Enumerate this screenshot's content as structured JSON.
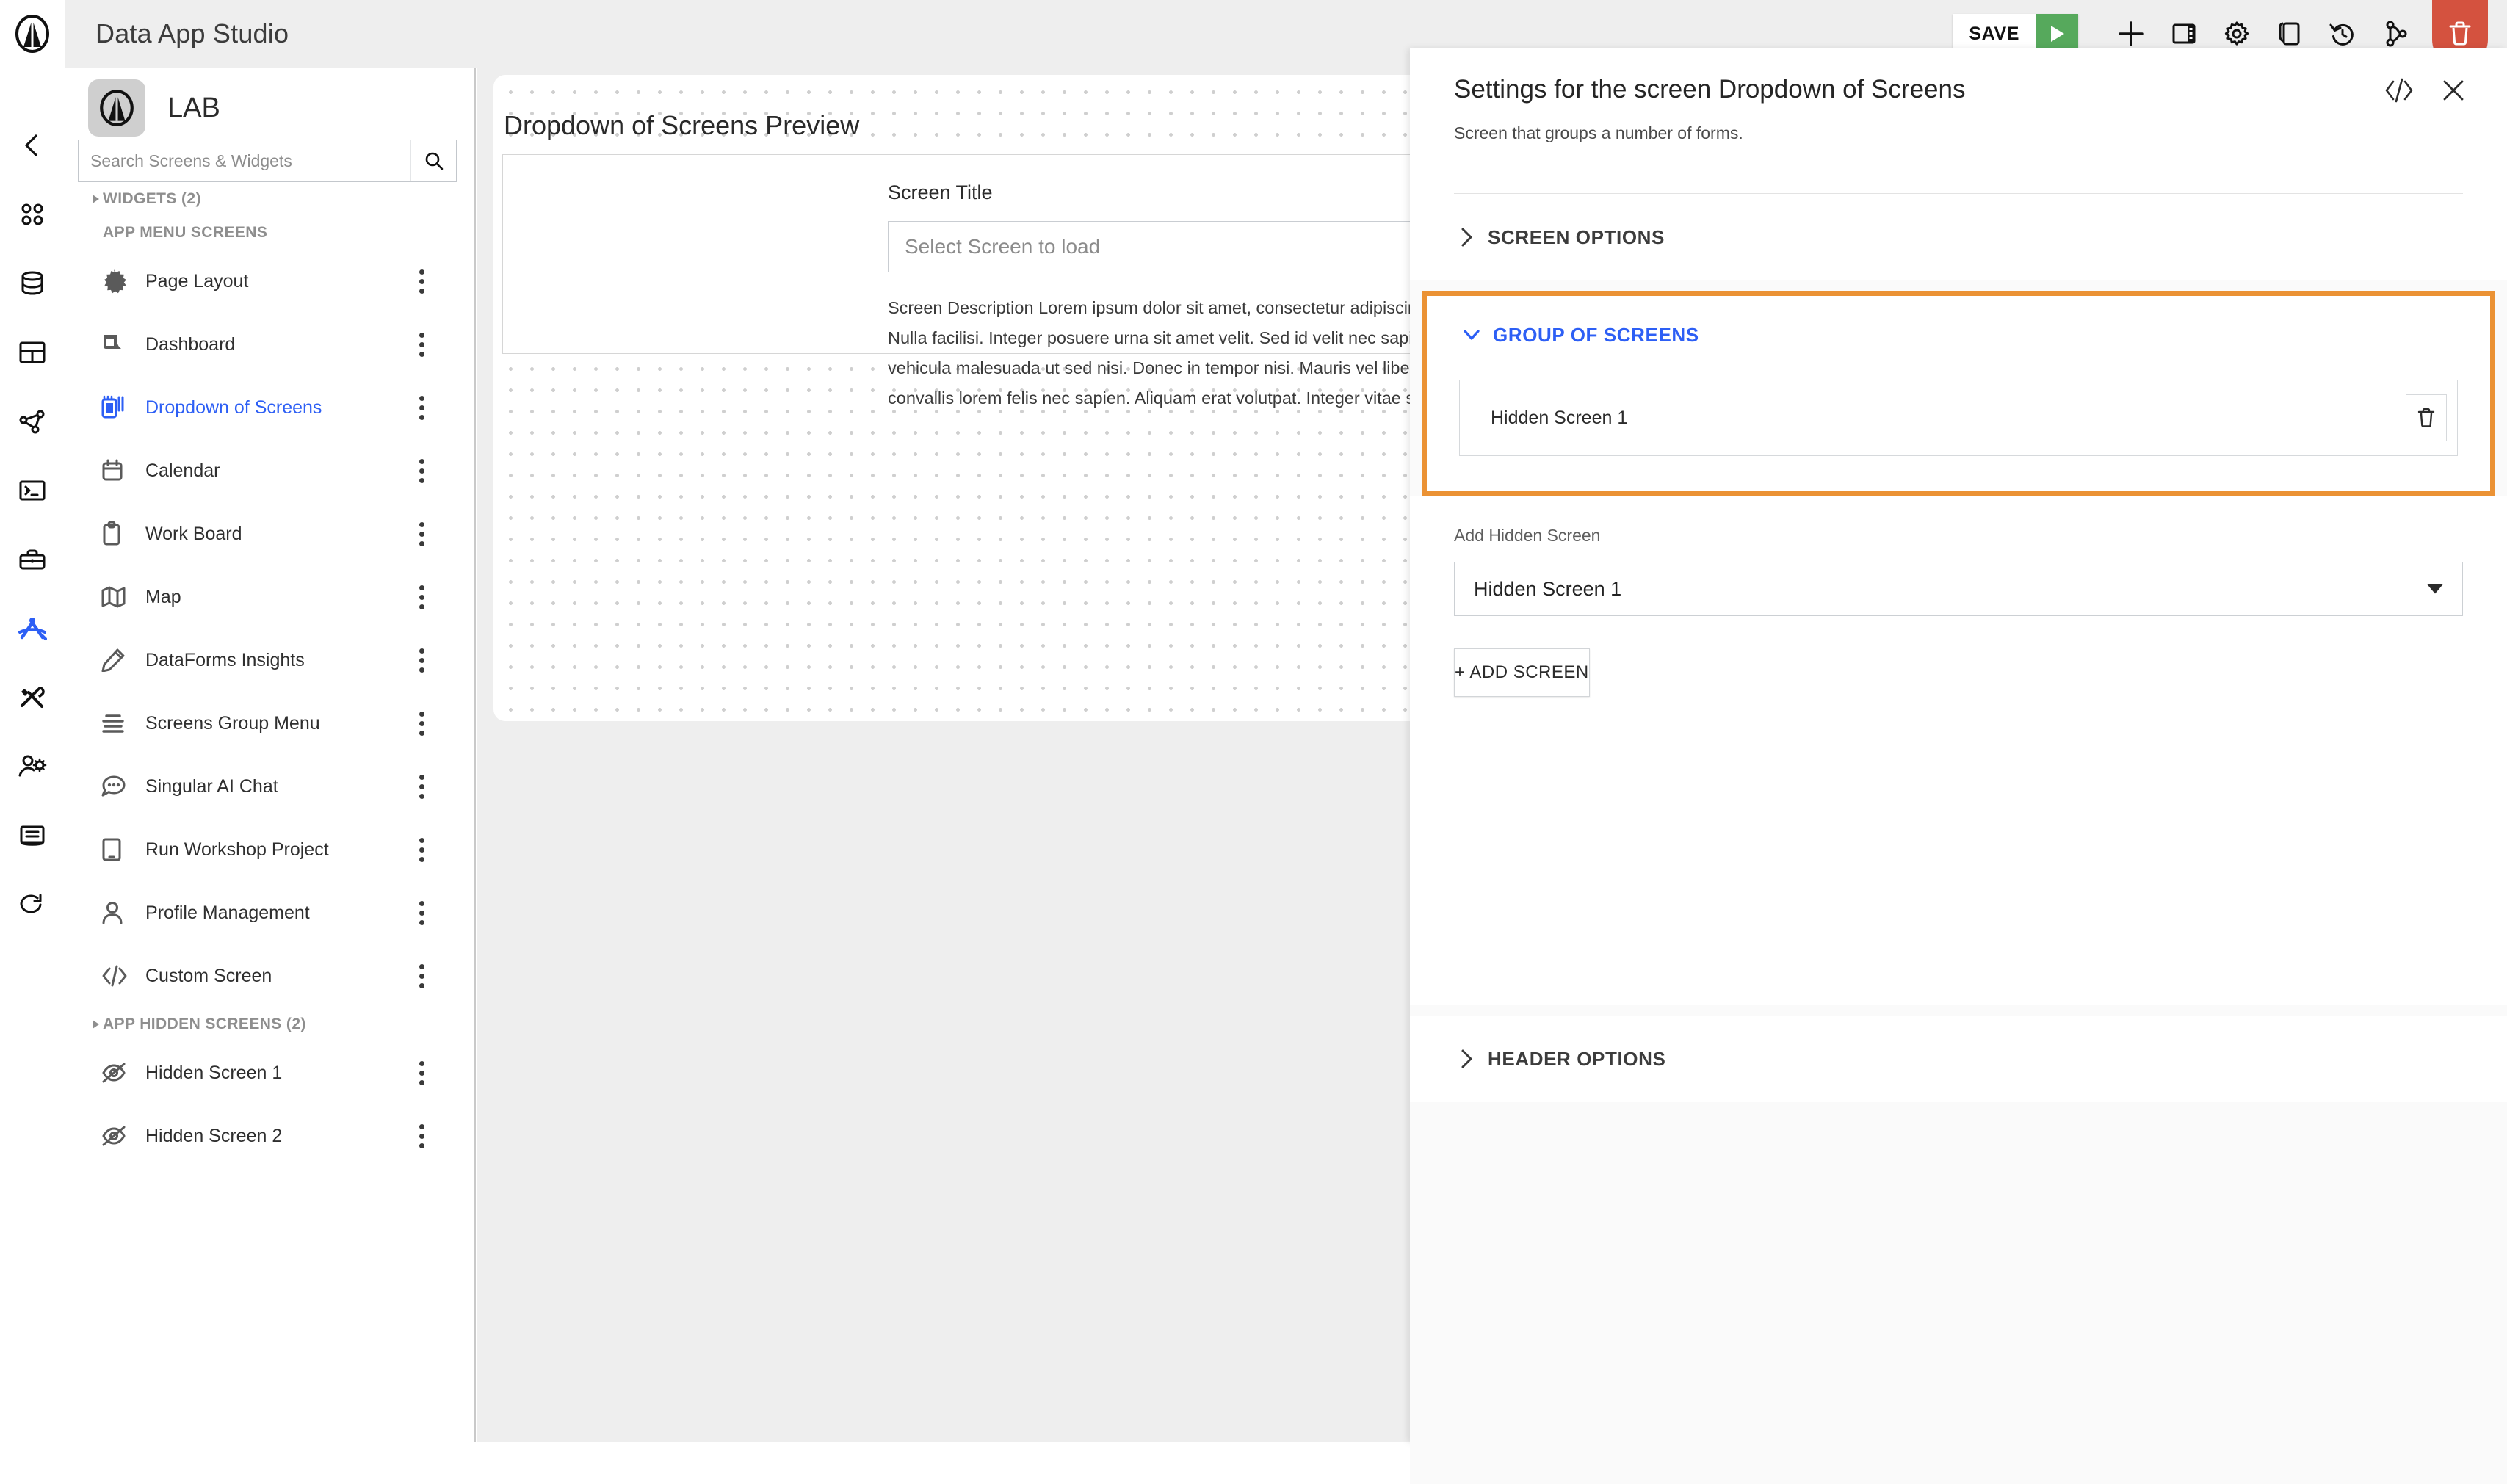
{
  "topbar": {
    "app_title": "Data App Studio",
    "logo_icon": "app-logo-circle-triangle",
    "save_label": "SAVE",
    "run_icon": "play-icon",
    "actions": [
      {
        "name": "add-icon",
        "glyph": "plus"
      },
      {
        "name": "panel-layout-icon",
        "glyph": "panel"
      },
      {
        "name": "settings-gear-icon",
        "glyph": "gear"
      },
      {
        "name": "duplicate-icon",
        "glyph": "copy"
      },
      {
        "name": "history-icon",
        "glyph": "history"
      },
      {
        "name": "branch-icon",
        "glyph": "branch"
      }
    ],
    "delete_icon": "trash-icon"
  },
  "rail": {
    "items": [
      {
        "name": "collapse-rail-button",
        "icon": "chevron-left-icon",
        "active": false
      },
      {
        "name": "rail-apps",
        "icon": "apps-grid-icon",
        "active": false
      },
      {
        "name": "rail-database",
        "icon": "database-icon",
        "active": false
      },
      {
        "name": "rail-table",
        "icon": "table-icon",
        "active": false
      },
      {
        "name": "rail-graph",
        "icon": "network-graph-icon",
        "active": false
      },
      {
        "name": "rail-terminal",
        "icon": "terminal-icon",
        "active": false
      },
      {
        "name": "rail-toolbox",
        "icon": "toolbox-icon",
        "active": false
      },
      {
        "name": "rail-studio",
        "icon": "compass-icon",
        "active": true
      },
      {
        "name": "rail-tools",
        "icon": "tools-icon",
        "active": false
      },
      {
        "name": "rail-user-settings",
        "icon": "user-gear-icon",
        "active": false
      },
      {
        "name": "rail-docs",
        "icon": "book-icon",
        "active": false
      },
      {
        "name": "rail-refresh",
        "icon": "refresh-icon",
        "active": false
      }
    ],
    "active_color": "#2d5ff5"
  },
  "sidebar": {
    "app_name": "LAB",
    "app_logo_icon": "app-logo-circle-triangle",
    "search": {
      "placeholder": "Search Screens & Widgets",
      "value": "",
      "icon": "search-icon"
    },
    "widgets_section": "WIDGETS (2)",
    "menu_section": "APP MENU SCREENS",
    "hidden_section": "APP HIDDEN SCREENS (2)",
    "menu_items": [
      {
        "label": "Page Layout",
        "icon": "starburst-icon"
      },
      {
        "label": "Dashboard",
        "icon": "dashboard-icon"
      },
      {
        "label": "Dropdown of Screens",
        "icon": "dropdown-screens-icon",
        "active": true
      },
      {
        "label": "Calendar",
        "icon": "calendar-icon"
      },
      {
        "label": "Work Board",
        "icon": "clipboard-icon"
      },
      {
        "label": "Map",
        "icon": "map-icon"
      },
      {
        "label": "DataForms Insights",
        "icon": "pencil-icon"
      },
      {
        "label": "Screens Group Menu",
        "icon": "menu-lines-icon"
      },
      {
        "label": "Singular AI Chat",
        "icon": "chat-bubble-icon"
      },
      {
        "label": "Run Workshop Project",
        "icon": "tablet-icon"
      },
      {
        "label": "Profile Management",
        "icon": "person-icon"
      },
      {
        "label": "Custom Screen",
        "icon": "code-icon"
      }
    ],
    "hidden_items": [
      {
        "label": "Hidden Screen 1",
        "icon": "eye-off-icon"
      },
      {
        "label": "Hidden Screen 2",
        "icon": "eye-off-icon"
      }
    ],
    "kebab_icon": "more-vertical-icon"
  },
  "canvas": {
    "title": "Dropdown of Screens Preview",
    "screen_title_label": "Screen Title",
    "select_placeholder": "Select Screen to load",
    "description": "Screen Description Lorem ipsum dolor sit amet, consectetur adipiscing elit. Nulla facilisi. Integer posuere urna sit amet velit. Sed id velit nec sapien vehicula malesuada ut sed nisi. Donec in tempor nisi. Mauris vel libero, ut convallis lorem felis nec sapien. Aliquam erat volutpat. Integer vitae sodales nunc. Donec vel felis sit amet semper luctus.",
    "annotation": {
      "name": "orange-arrow-annotation",
      "color": "#eb9234"
    }
  },
  "panel": {
    "title": "Settings for the screen Dropdown of Screens",
    "subtitle": "Screen that groups a number of forms.",
    "code_icon": "code-icon",
    "close_icon": "close-icon",
    "sections": {
      "screen_options": {
        "label": "SCREEN OPTIONS",
        "expanded": false,
        "chevron": "chevron-right-icon"
      },
      "group_of_screens": {
        "label": "GROUP OF SCREENS",
        "expanded": true,
        "chevron": "chevron-down-icon",
        "highlight_color": "#eb9234",
        "accent_color": "#2d5ff5",
        "rows": [
          {
            "label": "Hidden Screen 1",
            "delete_icon": "trash-icon"
          }
        ]
      },
      "header_options": {
        "label": "HEADER OPTIONS",
        "expanded": false,
        "chevron": "chevron-right-icon"
      }
    },
    "add_hidden_screen": {
      "label": "Add Hidden Screen",
      "selected": "Hidden Screen 1",
      "caret_icon": "chevron-down-icon"
    },
    "add_screen_button": "+ ADD SCREEN"
  }
}
